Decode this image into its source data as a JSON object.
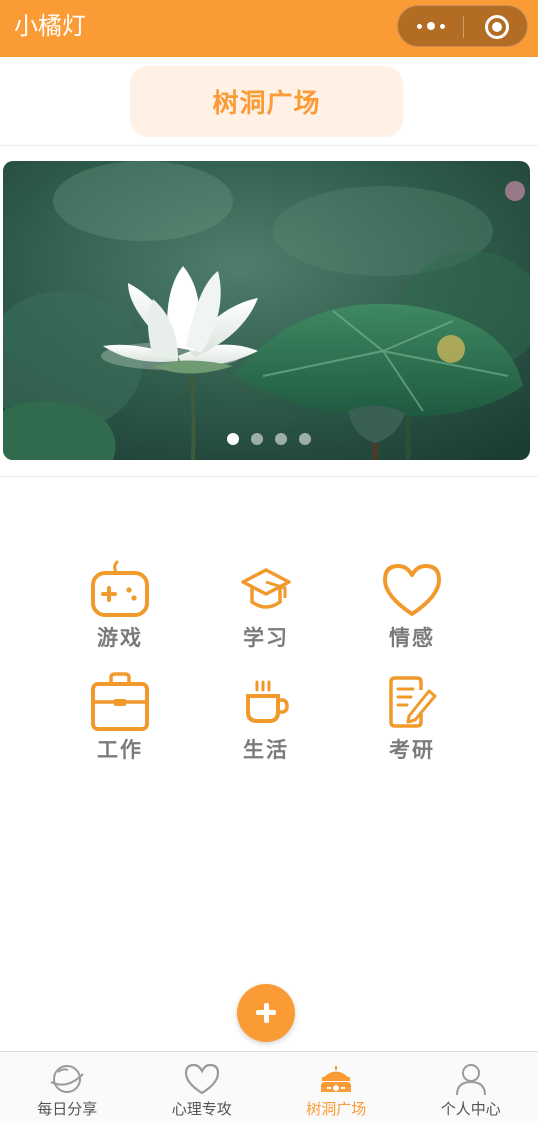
{
  "app": {
    "title": "小橘灯"
  },
  "header": {
    "title": "树洞广场"
  },
  "banner": {
    "slides": 4,
    "active_index": 0
  },
  "categories": [
    {
      "label": "游戏",
      "icon": "gamepad-icon"
    },
    {
      "label": "学习",
      "icon": "graduation-cap-icon"
    },
    {
      "label": "情感",
      "icon": "heart-icon"
    },
    {
      "label": "工作",
      "icon": "briefcase-icon"
    },
    {
      "label": "生活",
      "icon": "coffee-cup-icon"
    },
    {
      "label": "考研",
      "icon": "notepad-pen-icon"
    }
  ],
  "fab": {
    "label": "+",
    "icon": "plus-icon"
  },
  "tabbar": {
    "items": [
      {
        "label": "每日分享",
        "icon": "planet-icon",
        "active": false
      },
      {
        "label": "心理专攻",
        "icon": "heart-outline-icon",
        "active": false
      },
      {
        "label": "树洞广场",
        "icon": "carousel-icon",
        "active": true
      },
      {
        "label": "个人中心",
        "icon": "user-icon",
        "active": false
      }
    ]
  },
  "colors": {
    "accent": "#fb9b35",
    "accent_light": "#fff1e6",
    "text_muted": "#7b7b7b",
    "tab_inactive": "#555555"
  }
}
